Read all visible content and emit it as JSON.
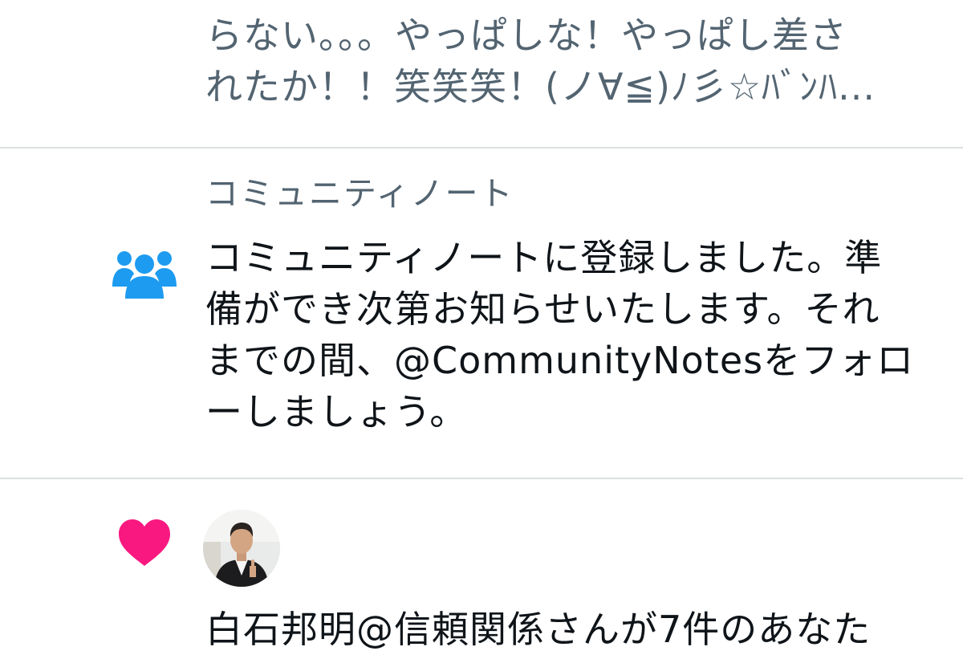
{
  "previous_tweet": {
    "lines": [
      "らない。。。やっぱしな！やっぱし差さ",
      "れたか！！笑笑笑！(ノ∀≦)ﾉ彡☆ﾊﾞﾝﾊ..."
    ]
  },
  "community_notes": {
    "title": "コミュニティノート",
    "icon": "people-icon",
    "body": "コミュニティノートに登録しました。準\n備ができ次第お知らせいたします。それ\nまでの間、@CommunityNotesをフォロ\nーしましょう。"
  },
  "like_notification": {
    "icon": "heart-icon",
    "text": "白石邦明@信頼関係さんが7件のあなた"
  },
  "colors": {
    "muted_text": "#536471",
    "dark_text": "#0f1419",
    "accent_blue": "#1d9bf0",
    "like_pink": "#f91880",
    "divider": "#dcdfe2"
  }
}
